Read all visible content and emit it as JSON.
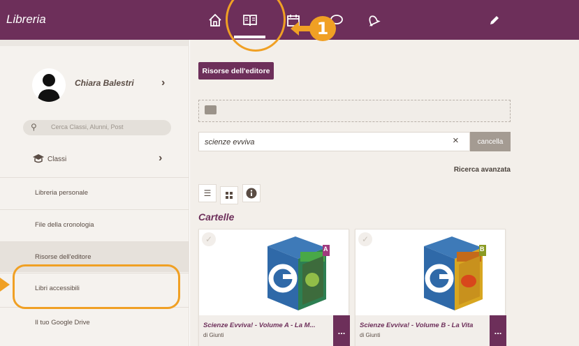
{
  "app": {
    "title": "Libreria"
  },
  "nav": {
    "items": [
      "home-icon",
      "book-icon",
      "calendar-icon",
      "chat-icon",
      "bell-icon",
      "pencil-icon"
    ],
    "active": "book-icon"
  },
  "annotation": {
    "number": "1"
  },
  "sidebar": {
    "user_name": "Chiara Balestri",
    "search_placeholder": "Cerca Classi, Alunni, Post",
    "classes_label": "Classi",
    "items": [
      {
        "label": "Libreria personale"
      },
      {
        "label": "File della cronologia"
      },
      {
        "label": "Risorse dell'editore"
      },
      {
        "label": "Libri accessibili"
      },
      {
        "label": "Il tuo Google Drive"
      }
    ],
    "active_item": "Risorse dell'editore"
  },
  "main": {
    "publisher_button": "Risorse dell'editore",
    "query": "scienze evviva",
    "clear_symbol": "×",
    "cancel_label": "cancella",
    "advanced_search": "Ricerca avanzata",
    "section_title": "Cartelle",
    "cards": [
      {
        "title": "Scienze Evviva! - Volume A - La M...",
        "author": "di Giunti",
        "more": "...",
        "cover_letter": "A",
        "cover_color": "#a03a7e"
      },
      {
        "title": "Scienze Evviva! - Volume B - La Vita",
        "author": "di Giunti",
        "more": "...",
        "cover_letter": "B",
        "cover_color": "#8a9a22"
      }
    ]
  },
  "colors": {
    "brand": "#6d2f5a",
    "annotation": "#f0a024",
    "sidebar_bg": "#f5f2ee"
  }
}
